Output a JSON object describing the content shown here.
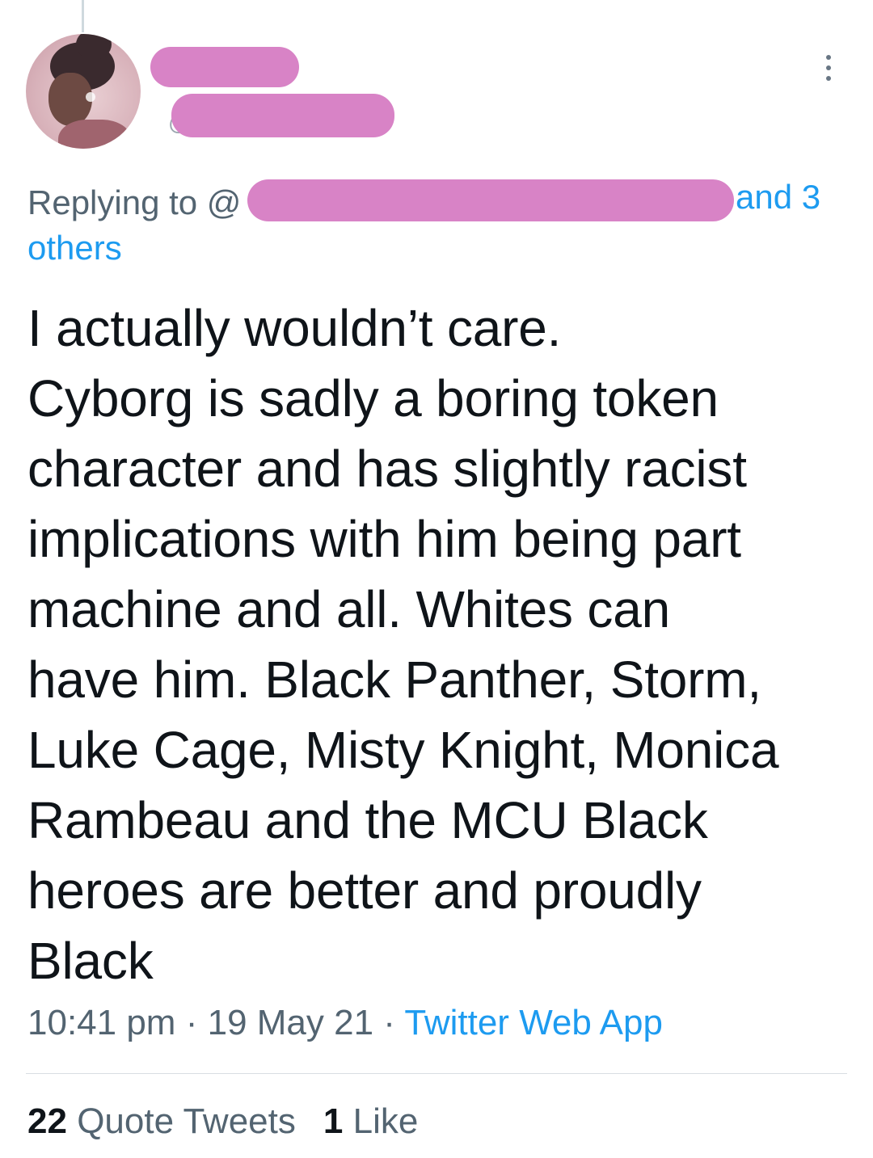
{
  "tweet": {
    "reply": {
      "prefix": "Replying to @",
      "suffix": "and 3",
      "others": "others"
    },
    "body_lines": [
      "I actually wouldn’t care.",
      "Cyborg is sadly a boring token",
      "character and has slightly racist",
      "implications with him being part",
      "machine and all. Whites can",
      "have him. Black Panther, Storm,",
      "Luke Cage, Misty Knight, Monica",
      "Rambeau and the MCU Black",
      "heroes are better and proudly",
      "Black"
    ],
    "time": "10:41 pm",
    "date": "19 May 21",
    "separator": "·",
    "source": "Twitter Web App",
    "stats": {
      "quote_count": "22",
      "quote_label": "Quote Tweets",
      "like_count": "1",
      "like_label": "Like"
    }
  },
  "icons": {
    "more": "more-options-icon"
  },
  "colors": {
    "link": "#1d9bf0",
    "muted": "#536471",
    "redaction": "#d883c6"
  }
}
